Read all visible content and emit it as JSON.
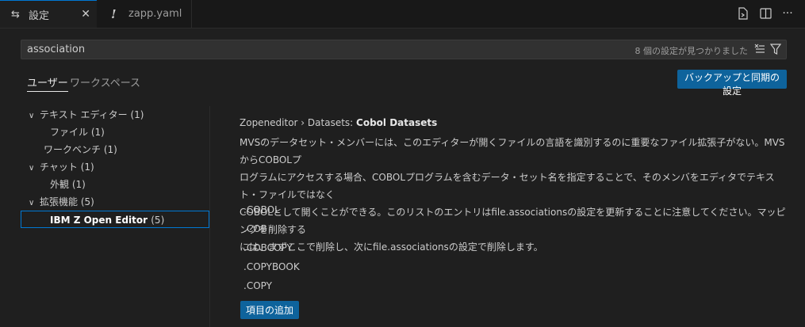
{
  "tabs": [
    {
      "label": "設定",
      "icon": "settings-icon",
      "active": true
    },
    {
      "label": "zapp.yaml",
      "icon": "yaml-warning-icon",
      "active": false
    }
  ],
  "tab_actions": [
    "open-settings-json-icon",
    "split-editor-icon",
    "more-actions-icon"
  ],
  "search": {
    "value": "association",
    "result_count": "8 個の設定が見つかりました"
  },
  "scope": {
    "user": "ユーザー",
    "workspace": "ワークスペース"
  },
  "sync_button": "バックアップと同期の設定",
  "toc": [
    {
      "label": "テキスト エディター",
      "count": "(1)",
      "expanded": true
    },
    {
      "label": "ファイル",
      "count": "(1)"
    },
    {
      "label": "ワークベンチ",
      "count": "(1)"
    },
    {
      "label": "チャット",
      "count": "(1)",
      "expanded": true
    },
    {
      "label": "外観",
      "count": "(1)"
    },
    {
      "label": "拡張機能",
      "count": "(5)",
      "expanded": true
    },
    {
      "label": "IBM Z Open Editor",
      "count": "(5)",
      "selected": true
    }
  ],
  "setting": {
    "prefix": "Zopeneditor › Datasets: ",
    "name": "Cobol Datasets",
    "description": [
      "MVSのデータセット・メンバーには、このエディターが開くファイルの言語を識別するのに重要なファイル拡張子がない。MVSからCOBOLプ",
      "ログラムにアクセスする場合、COBOLプログラムを含むデータ・セット名を指定することで、そのメンバをエディタでテキスト・ファイルではなく",
      "COBOLとして開くことができる。このリストのエントリはfile.associationsの設定を更新することに注意してください。マッピングを削除する",
      "には、まずここで削除し、次にfile.associationsの設定で削除します。"
    ],
    "items": [
      ".COBOL",
      ".COB",
      ".COBCOPY",
      ".COPYBOOK",
      ".COPY"
    ],
    "add_button": "項目の追加"
  },
  "colors": {
    "accent": "#0078d4",
    "button": "#0e639c",
    "background": "#1f1f1f"
  }
}
